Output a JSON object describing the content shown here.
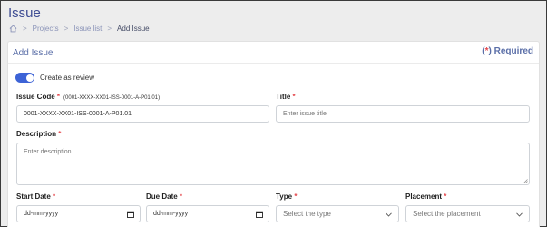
{
  "page": {
    "title": "Issue"
  },
  "breadcrumb": {
    "home_icon": "home-icon",
    "separator": ">",
    "items": [
      "Projects",
      "Issue list",
      "Add Issue"
    ]
  },
  "card": {
    "title": "Add Issue",
    "required_note": {
      "open": "(",
      "star": "*",
      "close": ")",
      "text": " Required"
    }
  },
  "review_toggle": {
    "label": "Create as review",
    "on": true
  },
  "issue_code": {
    "label": "Issue Code",
    "hint": "(0001-XXXX-XX01-ISS-0001-A-P01.01)",
    "value": "0001-XXXX-XX01-ISS-0001-A-P01.01"
  },
  "title_field": {
    "label": "Title",
    "placeholder": "Enter issue title"
  },
  "description": {
    "label": "Description",
    "placeholder": "Enter description"
  },
  "start_date": {
    "label": "Start Date",
    "placeholder": "dd-mm-yyyy"
  },
  "due_date": {
    "label": "Due Date",
    "placeholder": "dd-mm-yyyy"
  },
  "type": {
    "label": "Type",
    "placeholder": "Select the type"
  },
  "placement": {
    "label": "Placement",
    "placeholder": "Select the placement"
  },
  "required_star": "*",
  "colors": {
    "accent": "#3d63d6",
    "title": "#3f4d93",
    "required": "#e5484d"
  }
}
